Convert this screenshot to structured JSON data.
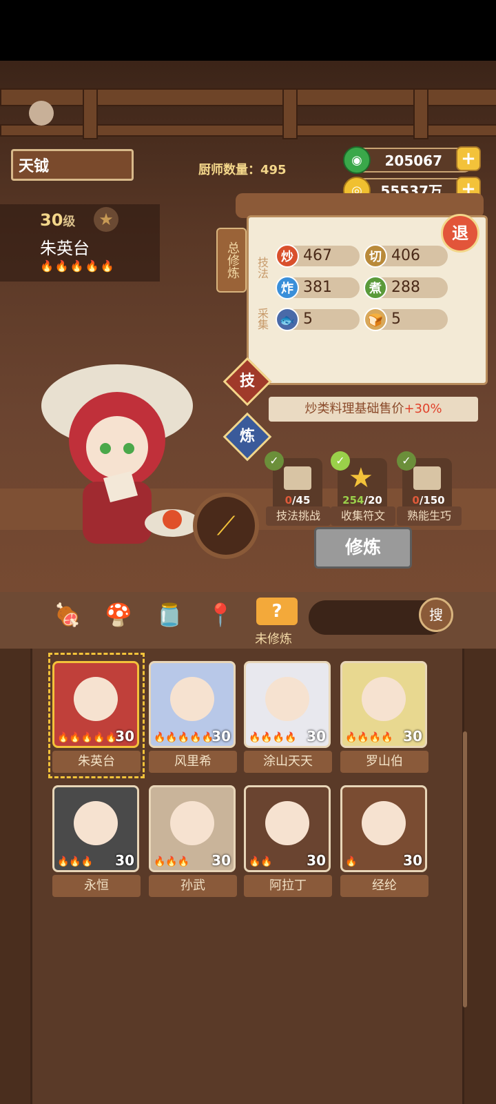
{
  "player": {
    "name": "天钺"
  },
  "chef_count_label": "厨师数量：495",
  "currency": {
    "jade": "205067",
    "coins": "55537万"
  },
  "chef": {
    "level": "30",
    "level_unit": "级",
    "name": "朱英台",
    "stars": "🔥🔥🔥🔥🔥"
  },
  "panel": {
    "total_tag": "总修炼",
    "skills_label": "技法",
    "gather_label": "采集",
    "stats": [
      {
        "icon": "炒",
        "value": "467",
        "color": "#d9502c"
      },
      {
        "icon": "切",
        "value": "406",
        "color": "#b98a3a"
      },
      {
        "icon": "炸",
        "value": "381",
        "color": "#3a8fd9"
      },
      {
        "icon": "煮",
        "value": "288",
        "color": "#5a9a3a"
      },
      {
        "icon": "🐟",
        "value": "5",
        "color": "#4a6aa8"
      },
      {
        "icon": "🍞",
        "value": "5",
        "color": "#d8a85a"
      }
    ],
    "exit_label": "退"
  },
  "tabs": {
    "skill": "技",
    "refine": "炼"
  },
  "bonus": {
    "text": "炒类料理基础售价",
    "highlight": "+30%"
  },
  "tasks": [
    {
      "count": "0",
      "total": "/45",
      "label": "技法挑战",
      "count_color": "#e05a3a"
    },
    {
      "count": "254",
      "total": "/20",
      "label": "收集符文",
      "count_color": "#9ad04a"
    },
    {
      "count": "0",
      "total": "/150",
      "label": "熟能生巧",
      "count_color": "#e05a3a"
    }
  ],
  "train_button": "修炼",
  "toolbar": {
    "active_label": "未修炼",
    "search_label": "搜"
  },
  "cards": [
    {
      "name": "朱英台",
      "level": "30",
      "flames": "🔥🔥🔥🔥🔥",
      "bg": "#c0403a",
      "icon": "portrait-red-hair"
    },
    {
      "name": "风里希",
      "level": "30",
      "flames": "🔥🔥🔥🔥🔥",
      "bg": "#b8c8e8",
      "icon": "portrait-silver-hair"
    },
    {
      "name": "涂山天天",
      "level": "30",
      "flames": "🔥🔥🔥🔥",
      "bg": "#e8e8ee",
      "icon": "portrait-white-fox"
    },
    {
      "name": "罗山伯",
      "level": "30",
      "flames": "🔥🔥🔥🔥",
      "bg": "#e8d890",
      "icon": "portrait-blond"
    },
    {
      "name": "永恒",
      "level": "30",
      "flames": "🔥🔥🔥",
      "bg": "#4a4a4a",
      "icon": "portrait-orb"
    },
    {
      "name": "孙武",
      "level": "30",
      "flames": "🔥🔥🔥",
      "bg": "#c9b49a",
      "icon": "portrait-bald"
    },
    {
      "name": "阿拉丁",
      "level": "30",
      "flames": "🔥🔥",
      "bg": "#6a4430",
      "icon": "portrait-blue-spirit"
    },
    {
      "name": "经纶",
      "level": "30",
      "flames": "🔥",
      "bg": "#7a4c32",
      "icon": "portrait-book"
    }
  ]
}
